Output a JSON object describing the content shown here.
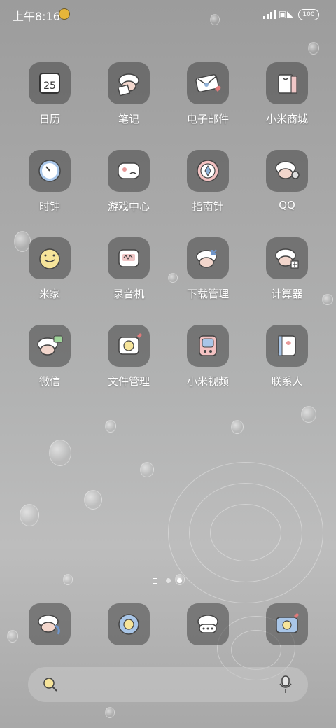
{
  "status_bar": {
    "time": "上午8:16",
    "battery": "100"
  },
  "apps": [
    {
      "label": "日历",
      "icon": "calendar-icon"
    },
    {
      "label": "笔记",
      "icon": "notes-icon"
    },
    {
      "label": "电子邮件",
      "icon": "email-icon"
    },
    {
      "label": "小米商城",
      "icon": "mi-store-icon"
    },
    {
      "label": "时钟",
      "icon": "clock-icon"
    },
    {
      "label": "游戏中心",
      "icon": "game-center-icon"
    },
    {
      "label": "指南针",
      "icon": "compass-icon"
    },
    {
      "label": "QQ",
      "icon": "qq-icon"
    },
    {
      "label": "米家",
      "icon": "mijia-icon"
    },
    {
      "label": "录音机",
      "icon": "recorder-icon"
    },
    {
      "label": "下载管理",
      "icon": "download-icon"
    },
    {
      "label": "计算器",
      "icon": "calculator-icon"
    },
    {
      "label": "微信",
      "icon": "wechat-icon"
    },
    {
      "label": "文件管理",
      "icon": "file-manager-icon"
    },
    {
      "label": "小米视频",
      "icon": "mi-video-icon"
    },
    {
      "label": "联系人",
      "icon": "contacts-icon"
    }
  ],
  "calendar_day": "25",
  "dock": [
    {
      "icon": "phone-icon"
    },
    {
      "icon": "browser-icon"
    },
    {
      "icon": "messages-icon"
    },
    {
      "icon": "camera-icon"
    }
  ],
  "search": {
    "icon": "search-icon",
    "mic_icon": "mic-icon"
  }
}
